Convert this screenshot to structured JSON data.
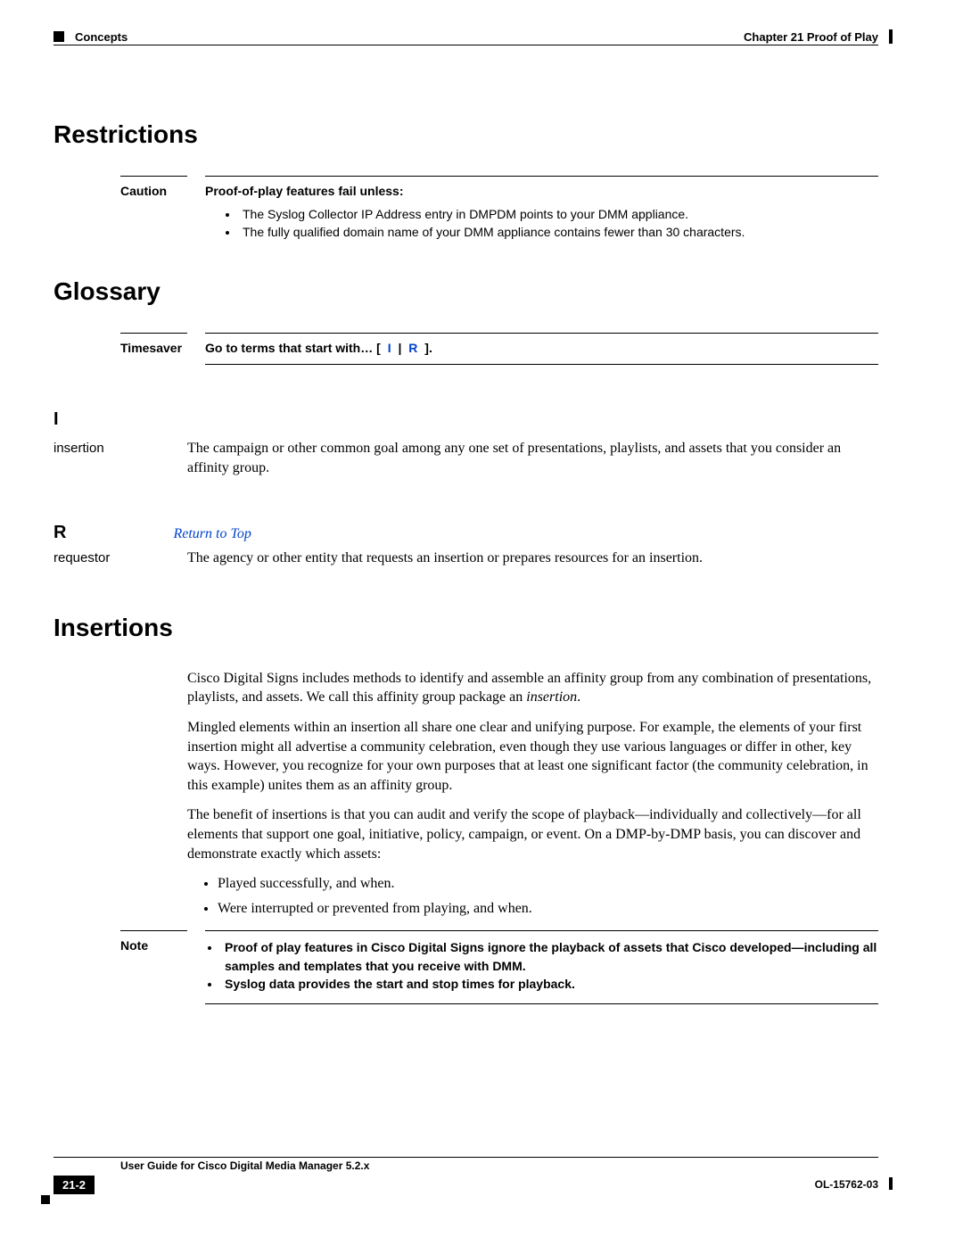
{
  "header": {
    "left": "Concepts",
    "right": "Chapter 21    Proof of Play"
  },
  "sections": {
    "restrictions_heading": "Restrictions",
    "glossary_heading": "Glossary",
    "insertions_heading": "Insertions"
  },
  "caution": {
    "label": "Caution",
    "lead": "Proof-of-play features fail unless:",
    "bullets": [
      "The Syslog Collector IP Address entry in DMPDM points to your DMM appliance.",
      "The fully qualified domain name of your DMM appliance contains fewer than 30 characters."
    ]
  },
  "timesaver": {
    "label": "Timesaver",
    "lead": "Go to terms that start with…   [",
    "link_I": "I",
    "sep": " | ",
    "link_R": "R",
    "tail": "]."
  },
  "glossary": {
    "letter_I": "I",
    "term_insertion": "insertion",
    "def_insertion": "The campaign or other common goal among any one set of presentations, playlists, and assets that you consider an affinity group.",
    "letter_R": "R",
    "return_top": "Return to Top",
    "term_requestor": "requestor",
    "def_requestor": "The agency or other entity that requests an insertion or prepares resources for an insertion."
  },
  "insertions": {
    "p1_a": "Cisco Digital Signs includes methods to identify and assemble an affinity group from any combination of presentations, playlists, and assets. We call this affinity group package an ",
    "p1_em": "insertion",
    "p1_b": ".",
    "p2": "Mingled elements within an insertion all share one clear and unifying purpose. For example, the elements of your first insertion might all advertise a community celebration, even though they use various languages or differ in other, key ways. However, you  recognize for your own purposes that at least one significant factor (the community celebration, in this example) unites them as an affinity group.",
    "p3": "The benefit of insertions is that you can audit and verify the scope of playback—individually and collectively—for all elements that support one goal, initiative, policy, campaign, or event. On a DMP-by-DMP basis, you can discover and demonstrate exactly which assets:",
    "bullets": [
      "Played successfully, and when.",
      "Were interrupted or prevented from playing, and when."
    ]
  },
  "note": {
    "label": "Note",
    "bullets": [
      "Proof of play features in Cisco Digital Signs ignore the playback of assets that Cisco developed—including all samples and templates that you receive with DMM.",
      "Syslog data provides the start and stop times for playback."
    ]
  },
  "footer": {
    "guide": "User Guide for Cisco Digital Media Manager 5.2.x",
    "page": "21-2",
    "docid": "OL-15762-03"
  }
}
